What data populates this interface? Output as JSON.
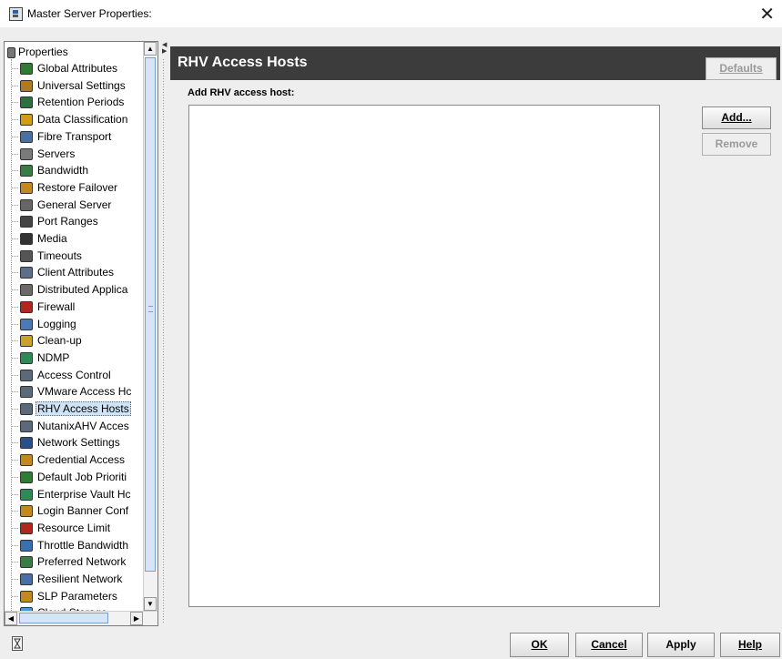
{
  "window": {
    "title": "Master Server Properties:",
    "close_glyph": "✕"
  },
  "tree": {
    "root_label": "Properties",
    "selected_index": 21,
    "items": [
      {
        "label": "Global Attributes",
        "icon": "globe-icon",
        "color": "#2e7d32"
      },
      {
        "label": "Universal Settings",
        "icon": "settings-icon",
        "color": "#b07a1e"
      },
      {
        "label": "Retention Periods",
        "icon": "retention-icon",
        "color": "#2f6f3f"
      },
      {
        "label": "Data Classification",
        "icon": "data-classification-icon",
        "color": "#d49a1a"
      },
      {
        "label": "Fibre Transport",
        "icon": "fibre-transport-icon",
        "color": "#4a6fa5"
      },
      {
        "label": "Servers",
        "icon": "server-icon",
        "color": "#7a7a7a"
      },
      {
        "label": "Bandwidth",
        "icon": "bandwidth-icon",
        "color": "#3a7d44"
      },
      {
        "label": "Restore Failover",
        "icon": "restore-failover-icon",
        "color": "#c28a1e"
      },
      {
        "label": "General Server",
        "icon": "general-server-icon",
        "color": "#666666"
      },
      {
        "label": "Port Ranges",
        "icon": "port-ranges-icon",
        "color": "#444444"
      },
      {
        "label": "Media",
        "icon": "media-icon",
        "color": "#333333"
      },
      {
        "label": "Timeouts",
        "icon": "timeouts-icon",
        "color": "#555555"
      },
      {
        "label": "Client Attributes",
        "icon": "client-attributes-icon",
        "color": "#5b6f8a"
      },
      {
        "label": "Distributed Applica",
        "icon": "distributed-app-icon",
        "color": "#6a6a6a"
      },
      {
        "label": "Firewall",
        "icon": "firewall-icon",
        "color": "#b3261e"
      },
      {
        "label": "Logging",
        "icon": "logging-icon",
        "color": "#4a7bb7"
      },
      {
        "label": "Clean-up",
        "icon": "cleanup-icon",
        "color": "#c9a227"
      },
      {
        "label": "NDMP",
        "icon": "ndmp-icon",
        "color": "#2e8b57"
      },
      {
        "label": "Access Control",
        "icon": "access-control-icon",
        "color": "#5a6a7a"
      },
      {
        "label": "VMware Access Hc",
        "icon": "vmware-hosts-icon",
        "color": "#5a6a7a"
      },
      {
        "label": "RHV Access Hosts",
        "icon": "rhv-hosts-icon",
        "color": "#5a6a7a"
      },
      {
        "label": "NutanixAHV Acces",
        "icon": "nutanix-hosts-icon",
        "color": "#5a6a7a"
      },
      {
        "label": "Network Settings",
        "icon": "network-settings-icon",
        "color": "#2b4f8a"
      },
      {
        "label": "Credential Access",
        "icon": "credential-access-icon",
        "color": "#c28a1e"
      },
      {
        "label": "Default Job Prioriti",
        "icon": "job-priority-icon",
        "color": "#2e7d32"
      },
      {
        "label": "Enterprise Vault Hc",
        "icon": "enterprise-vault-icon",
        "color": "#2e8b57"
      },
      {
        "label": "Login Banner Conf",
        "icon": "login-banner-icon",
        "color": "#c28a1e"
      },
      {
        "label": "Resource Limit",
        "icon": "resource-limit-icon",
        "color": "#b3261e"
      },
      {
        "label": "Throttle Bandwidth",
        "icon": "throttle-bandwidth-icon",
        "color": "#3a6fb0"
      },
      {
        "label": "Preferred Network",
        "icon": "preferred-network-icon",
        "color": "#3a7d44"
      },
      {
        "label": "Resilient Network",
        "icon": "resilient-network-icon",
        "color": "#4a6fa5"
      },
      {
        "label": "SLP Parameters",
        "icon": "slp-parameters-icon",
        "color": "#c28a1e"
      },
      {
        "label": "Cloud Storage",
        "icon": "cloud-storage-icon",
        "color": "#4a9ad4"
      }
    ]
  },
  "panel": {
    "title": "RHV Access Hosts",
    "defaults_label": "Defaults",
    "add_host_label": "Add RHV access host:",
    "add_label": "Add...",
    "remove_label": "Remove"
  },
  "footer": {
    "ok_label": "OK",
    "cancel_label": "Cancel",
    "apply_label": "Apply",
    "help_label": "Help"
  }
}
